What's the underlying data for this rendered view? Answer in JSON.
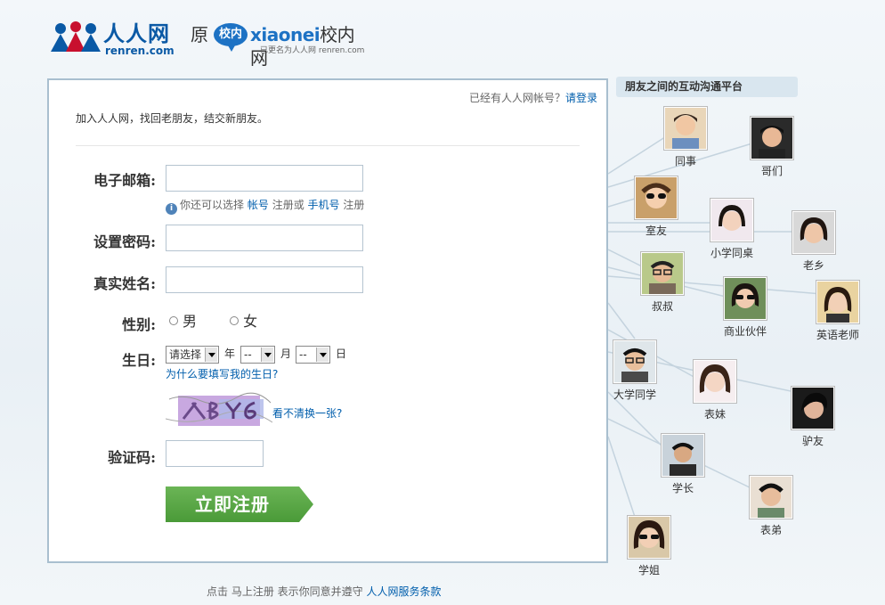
{
  "header": {
    "logo_cn": "人人网",
    "logo_en": "renren.com",
    "xn_yuan": "原",
    "xn_bubble": "校内",
    "xn_word": "xiaonei",
    "xn_word_cn": "校内网",
    "xn_sub": "已更名为人人网 renren.com"
  },
  "panel": {
    "login_prompt": "已经有人人网帐号？",
    "login_link": "请登录",
    "intro": "加入人人网，找回老朋友，结交新朋友。",
    "email_label": "电子邮箱:",
    "email_value": "",
    "hint_prefix": "你还可以选择",
    "hint_account": "帐号",
    "hint_mid": "注册或",
    "hint_phone": "手机号",
    "hint_suffix": "注册",
    "password_label": "设置密码:",
    "password_value": "",
    "name_label": "真实姓名:",
    "name_value": "",
    "gender_label": "性别:",
    "gender_male": "男",
    "gender_female": "女",
    "birthday_label": "生日:",
    "year_select": "请选择",
    "year_unit": "年",
    "month_select": "--",
    "month_unit": "月",
    "day_select": "--",
    "day_unit": "日",
    "why_birthday": "为什么要填写我的生日?",
    "captcha_change": "看不清换一张?",
    "captcha_label": "验证码:",
    "captcha_value": "",
    "submit": "立即注册"
  },
  "footer": {
    "text": "点击  马上注册  表示你同意并遵守",
    "link": "人人网服务条款"
  },
  "network": {
    "title": "朋友之间的互动沟通平台",
    "friends": [
      {
        "name": "同事"
      },
      {
        "name": "哥们"
      },
      {
        "name": "室友"
      },
      {
        "name": "小学同桌"
      },
      {
        "name": "老乡"
      },
      {
        "name": "叔叔"
      },
      {
        "name": "商业伙伴"
      },
      {
        "name": "英语老师"
      },
      {
        "name": "大学同学"
      },
      {
        "name": "表妹"
      },
      {
        "name": "驴友"
      },
      {
        "name": "学长"
      },
      {
        "name": "表弟"
      },
      {
        "name": "学姐"
      }
    ]
  },
  "colors": {
    "brand_blue": "#0a59a5",
    "link_blue": "#005eac",
    "submit_green": "#4a9a38"
  }
}
